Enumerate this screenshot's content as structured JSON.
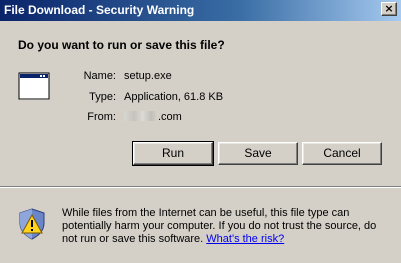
{
  "window": {
    "title": "File Download - Security Warning",
    "close_glyph": "×"
  },
  "question": "Do you want to run or save this file?",
  "file_icon": "application-window-icon",
  "fields": {
    "name_label": "Name:",
    "name_value": "setup.exe",
    "type_label": "Type:",
    "type_value": "Application, 61.8 KB",
    "from_label": "From:",
    "from_value_suffix": ".com"
  },
  "buttons": {
    "run": "Run",
    "save": "Save",
    "cancel": "Cancel"
  },
  "warning_icon": "shield-warning-icon",
  "warning": {
    "text": "While files from the Internet can be useful, this file type can potentially harm your computer. If you do not trust the source, do not run or save this software. ",
    "link": "What's the risk?"
  },
  "colors": {
    "titlebar": "#0a246a",
    "dialog_bg": "#d4d0c8",
    "link": "#0000ee"
  }
}
